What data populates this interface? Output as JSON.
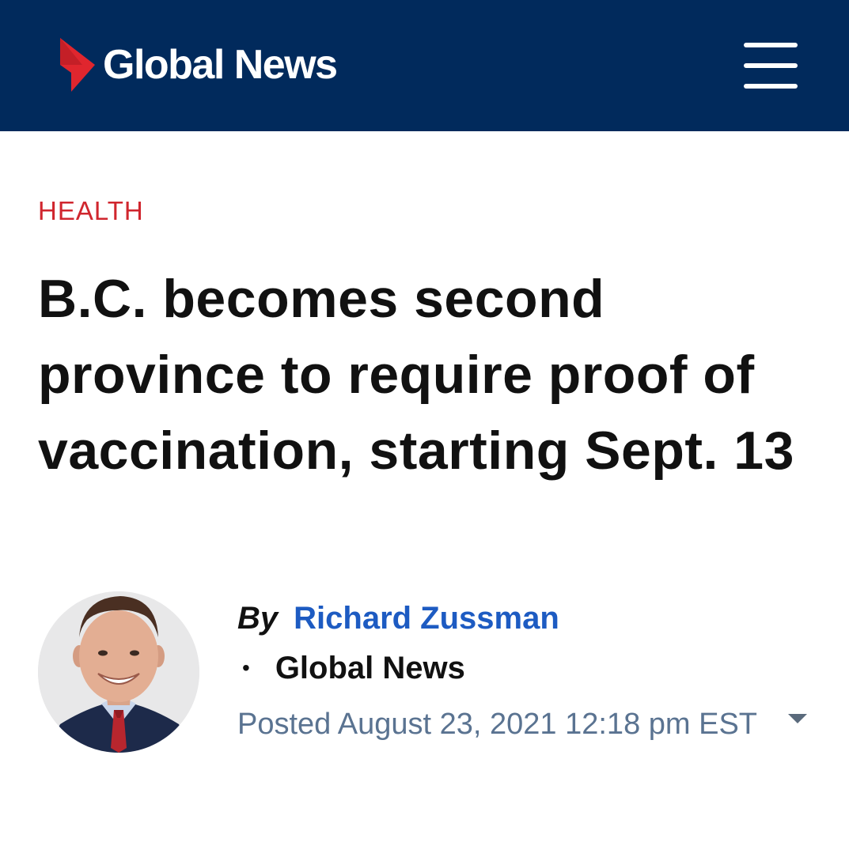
{
  "header": {
    "brand_name": "Global News",
    "brand_color": "#012a5c",
    "accent_color": "#e0262e",
    "menu_icon": "hamburger-menu-icon"
  },
  "article": {
    "category": "HEALTH",
    "headline": "B.C. becomes second province to require proof of vaccination, starting Sept. 13",
    "byline": {
      "by_label": "By",
      "author": "Richard Zussman",
      "bullet": "•",
      "source": "Global News",
      "posted": "Posted August 23, 2021 12:18 pm EST"
    },
    "avatar_icon": "author-photo",
    "expand_icon": "caret-down-icon"
  }
}
